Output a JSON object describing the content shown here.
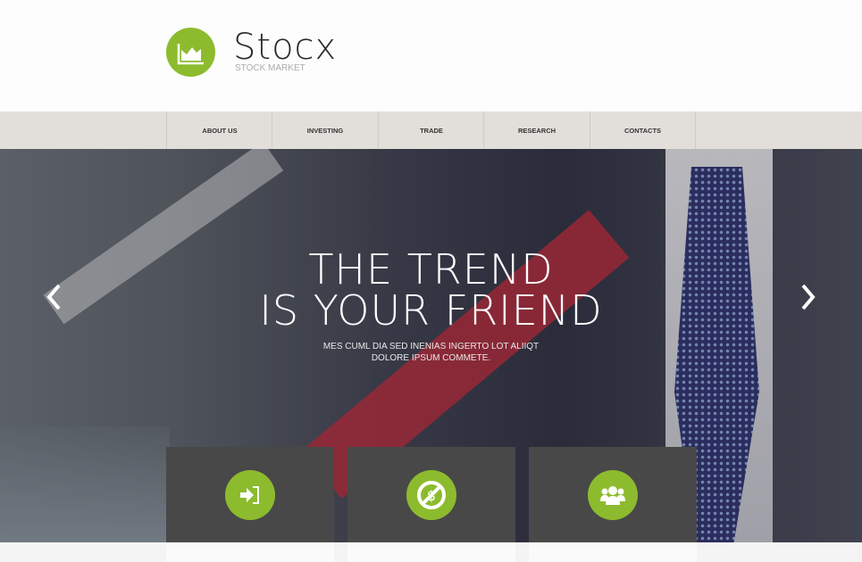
{
  "logo": {
    "name": "Stocx",
    "tagline": "STOCK MARKET",
    "icon": "chart-area-icon"
  },
  "nav": {
    "items": [
      "ABOUT US",
      "INVESTING",
      "TRADE",
      "RESEARCH",
      "CONTACTS"
    ]
  },
  "hero": {
    "title_line1": "THE TREND",
    "title_line2": "IS YOUR FRIEND",
    "subtitle_line1": "MES CUML DIA SED INENIAS INGERTO LOT ALIIQT",
    "subtitle_line2": "DOLORE IPSUM COMMETE.",
    "prev_icon": "chevron-left-icon",
    "next_icon": "chevron-right-icon"
  },
  "features": [
    {
      "icon": "sign-in-icon"
    },
    {
      "icon": "no-dollar-icon"
    },
    {
      "icon": "users-icon"
    }
  ],
  "colors": {
    "accent": "#8dbb2e",
    "nav_bg": "#e2dfdb",
    "box_bg": "#484848"
  }
}
